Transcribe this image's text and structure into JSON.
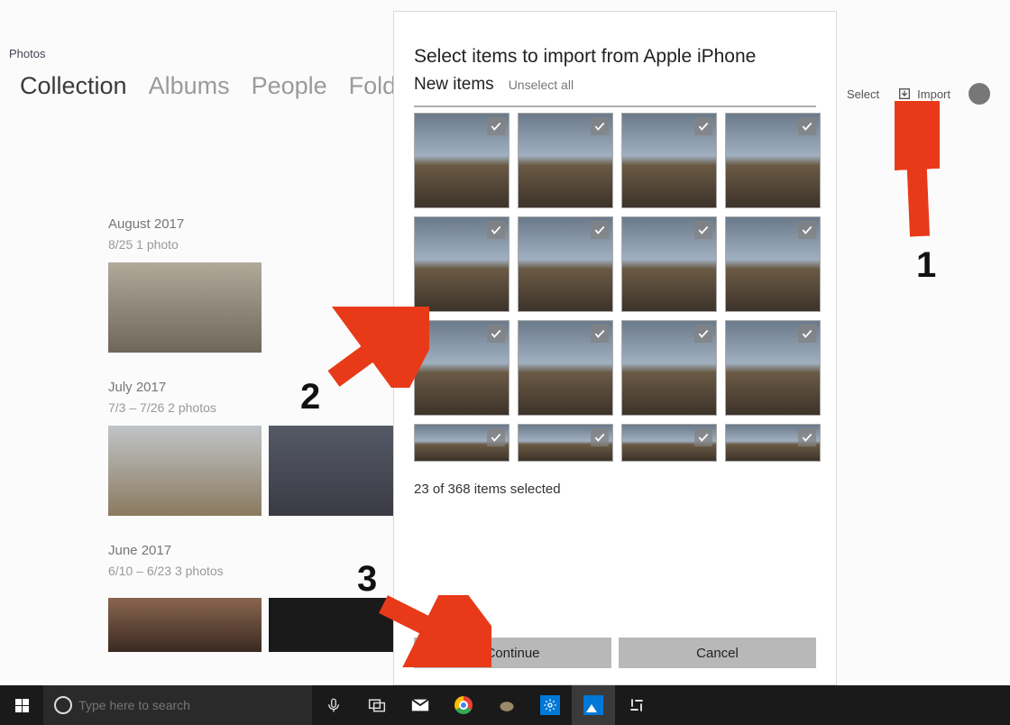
{
  "app": {
    "title": "Photos"
  },
  "tabs": {
    "collection": "Collection",
    "albums": "Albums",
    "people": "People",
    "folders": "Folders"
  },
  "tools": {
    "select": "Select",
    "import": "Import"
  },
  "groups": [
    {
      "title": "August 2017",
      "sub": "8/25   1 photo"
    },
    {
      "title": "July 2017",
      "sub": "7/3 – 7/26   2 photos"
    },
    {
      "title": "June 2017",
      "sub": "6/10 – 6/23   3 photos"
    }
  ],
  "dialog": {
    "title": "Select items to import from Apple iPhone",
    "new_items": "New items",
    "unselect": "Unselect all",
    "status": "23 of 368 items selected",
    "continue": "Continue",
    "cancel": "Cancel"
  },
  "anno": {
    "n1": "1",
    "n2": "2",
    "n3": "3"
  },
  "taskbar": {
    "search_placeholder": "Type here to search"
  }
}
